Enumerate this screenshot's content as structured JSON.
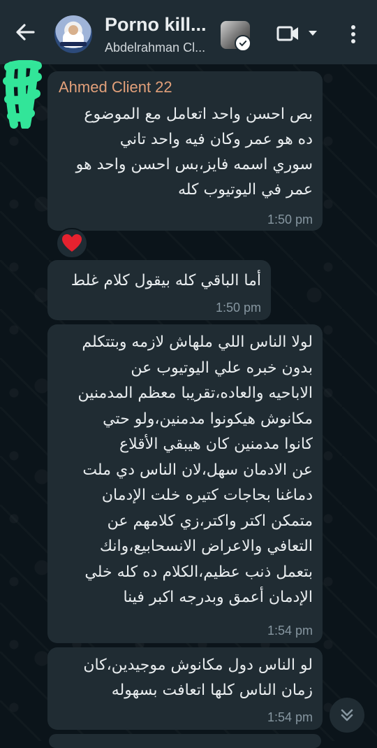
{
  "header": {
    "title": "Porno kill...",
    "subtitle": "Abdelrahman Cl..."
  },
  "messages": [
    {
      "sender": "Ahmed Client 22",
      "lines": [
        "بص احسن واحد اتعامل مع الموضوع",
        "ده هو عمر وكان فيه واحد تاني",
        "سوري اسمه فايز،بس احسن واحد هو",
        "عمر في اليوتيوب كله"
      ],
      "time": "1:50 pm",
      "reaction": "❤️"
    },
    {
      "lines": [
        "أما الباقي كله بيقول كلام غلط"
      ],
      "time": "1:50 pm"
    },
    {
      "lines": [
        "لولا الناس اللي ملهاش لازمه وبتتكلم",
        "بدون خبره علي اليوتيوب عن",
        "الاباحيه والعاده،تقريبا معظم المدمنين",
        "مكانوش هيكونوا مدمنين،ولو حتي",
        "كانوا مدمنين كان هيبقي الأقلاع",
        "عن الادمان سهل،لان الناس دي ملت",
        "دماغنا بحاجات كتيره خلت الإدمان",
        "متمكن اكتر واكتر،زي كلامهم عن",
        "التعافي والاعراض الانسحابيع،وانك",
        "بتعمل ذنب عظيم،الكلام ده كله خلي",
        "الإدمان أعمق وبدرجه اكبر فينا"
      ],
      "time": "1:54 pm"
    },
    {
      "lines": [
        "لو الناس دول مكانوش موجيدين،كان",
        "زمان الناس كلها اتعافت بسهوله"
      ],
      "time": "1:54 pm"
    }
  ],
  "icons": {
    "back": "arrow-left-icon",
    "video": "video-call-icon",
    "dropdown": "caret-down-icon",
    "menu": "more-vertical-icon",
    "scroll": "double-chevron-down-icon"
  },
  "colors": {
    "background": "#0b141a",
    "header": "#1f2c34",
    "bubble": "#202c33",
    "sender": "#e2a07a",
    "time": "#8696a0",
    "scribble": "#35f0a0"
  }
}
